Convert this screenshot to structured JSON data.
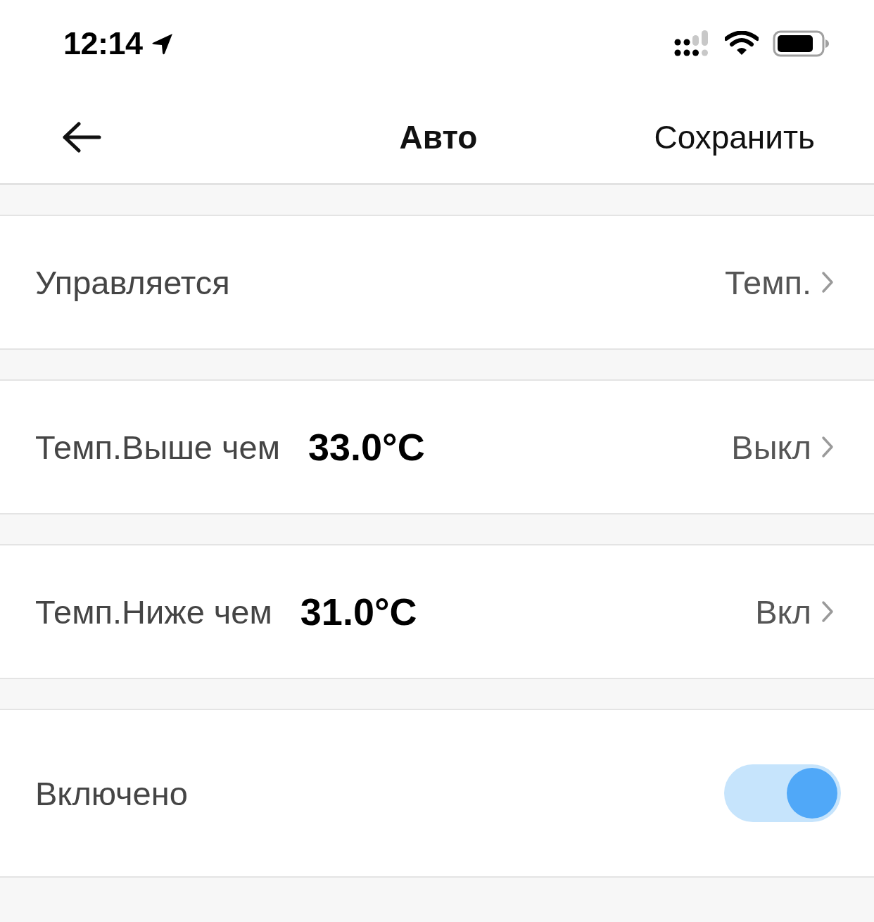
{
  "status_bar": {
    "time": "12:14"
  },
  "nav": {
    "title": "Авто",
    "action": "Сохранить"
  },
  "rows": [
    {
      "kind": "link",
      "label": "Управляется",
      "value": "Темп."
    },
    {
      "kind": "threshold",
      "label": "Темп.Выше чем",
      "reading": "33.0°C",
      "value": "Выкл"
    },
    {
      "kind": "threshold",
      "label": "Темп.Ниже чем",
      "reading": "31.0°C",
      "value": "Вкл"
    },
    {
      "kind": "toggle",
      "label": "Включено",
      "on": true
    }
  ]
}
